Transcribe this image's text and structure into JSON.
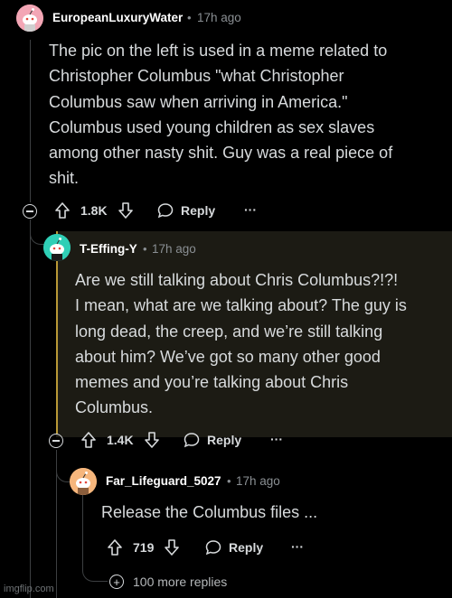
{
  "comments": [
    {
      "username": "EuropeanLuxuryWater",
      "time": "17h ago",
      "lines": [
        "The pic on the left is used in a meme related to",
        "Christopher Columbus \"what Christopher",
        "Columbus saw when arriving in America.\"",
        "Columbus used young children as sex slaves",
        "among other nasty shit. Guy was a real piece of",
        "shit."
      ],
      "votes": "1.8K",
      "reply_label": "Reply",
      "more_label": "···"
    },
    {
      "username": "T-Effing-Y",
      "time": "17h ago",
      "lines": [
        "Are we still talking about Chris Columbus?!?!",
        "I mean, what are we talking about? The guy is",
        "long dead, the creep, and we’re still talking",
        "about him? We’ve got so many other good",
        "memes and you’re talking about Chris",
        "Columbus."
      ],
      "votes": "1.4K",
      "reply_label": "Reply",
      "more_label": "···"
    },
    {
      "username": "Far_Lifeguard_5027",
      "time": "17h ago",
      "lines": [
        "Release the Columbus files ..."
      ],
      "votes": "719",
      "reply_label": "Reply",
      "more_label": "···"
    }
  ],
  "more_replies": "100 more replies",
  "separator": "•",
  "watermark": "imgflip.com",
  "colors": {
    "background": "#000000",
    "highlight": "#1c1b14",
    "accent_bar": "#b89836",
    "text": "#d7dadc",
    "meta": "#8a8f93"
  }
}
